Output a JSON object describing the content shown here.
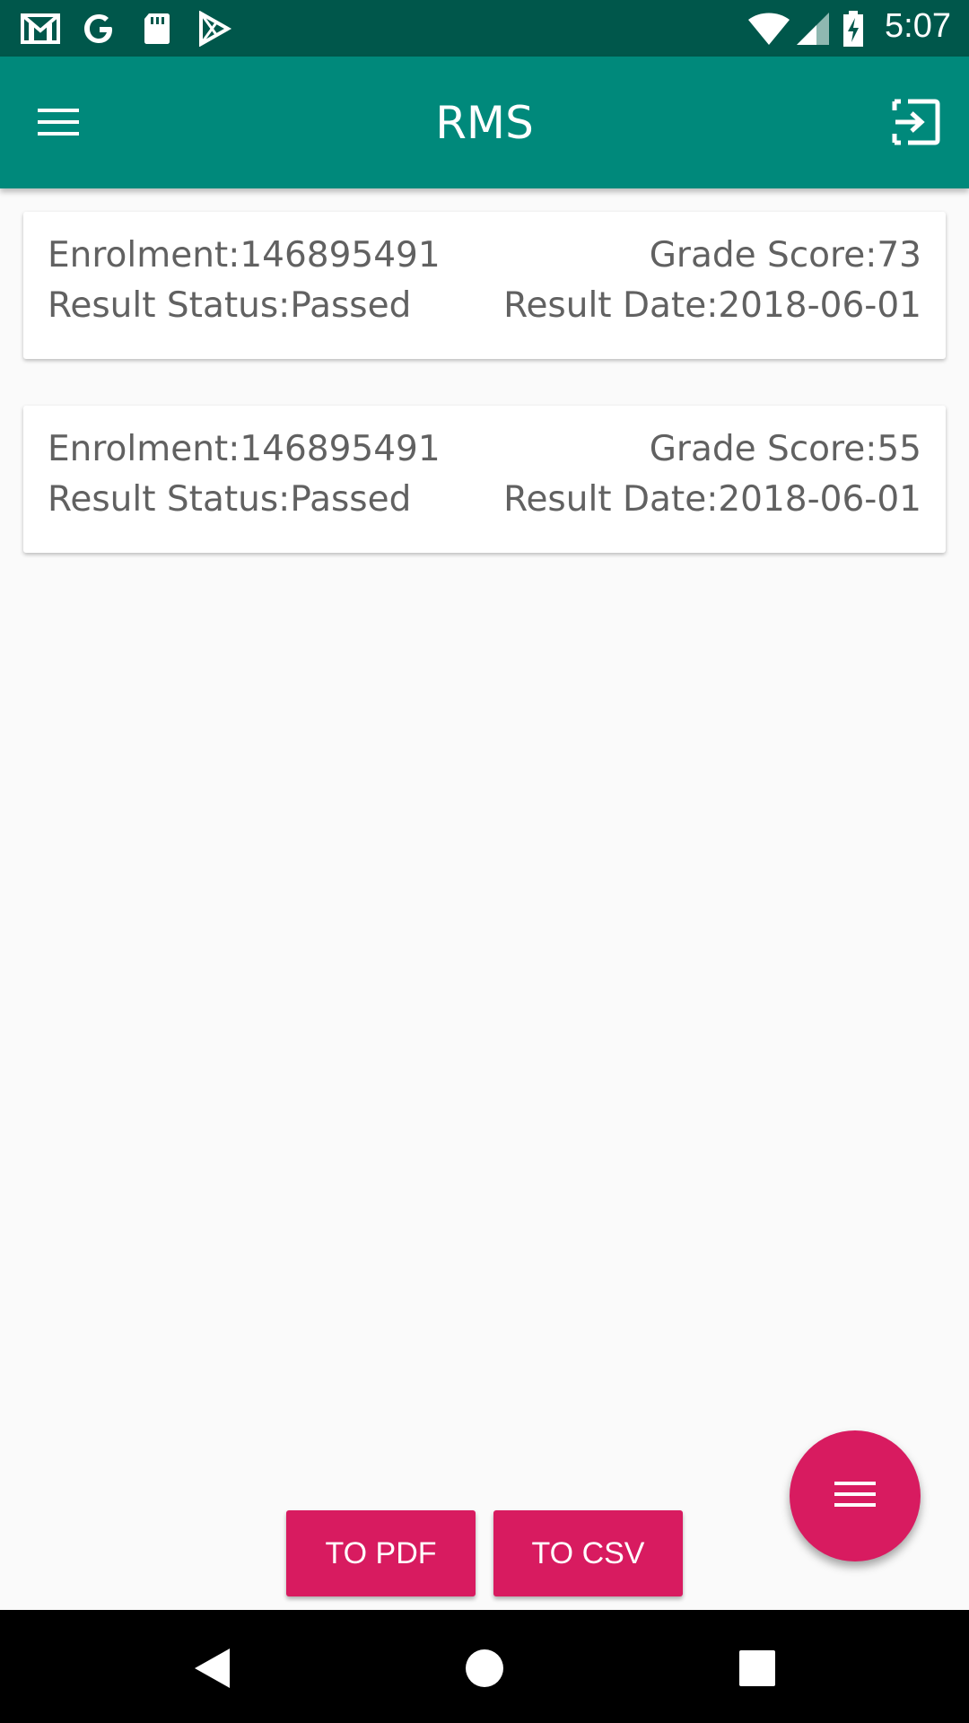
{
  "status_bar": {
    "time": "5:07",
    "icons": [
      "gmail-icon",
      "google-icon",
      "sd-card-icon",
      "play-store-icon",
      "wifi-icon",
      "signal-icon",
      "battery-charging-icon"
    ]
  },
  "app_bar": {
    "title": "RMS",
    "menu_icon": "hamburger-menu-icon",
    "logout_icon": "exit-icon"
  },
  "results": [
    {
      "enrolment": "Enrolment:146895491",
      "grade_score": "Grade Score:73",
      "result_status": "Result Status:Passed",
      "result_date": "Result Date:2018-06-01"
    },
    {
      "enrolment": "Enrolment:146895491",
      "grade_score": "Grade Score:55",
      "result_status": "Result Status:Passed",
      "result_date": "Result Date:2018-06-01"
    }
  ],
  "actions": {
    "to_pdf": "TO PDF",
    "to_csv": "TO CSV",
    "fab_icon": "menu-icon"
  },
  "nav_bar": {
    "icons": [
      "back-icon",
      "home-icon",
      "recents-icon"
    ]
  },
  "colors": {
    "status_bar": "#00574b",
    "app_bar": "#00897b",
    "accent": "#d81b60",
    "background": "#fafafa"
  }
}
